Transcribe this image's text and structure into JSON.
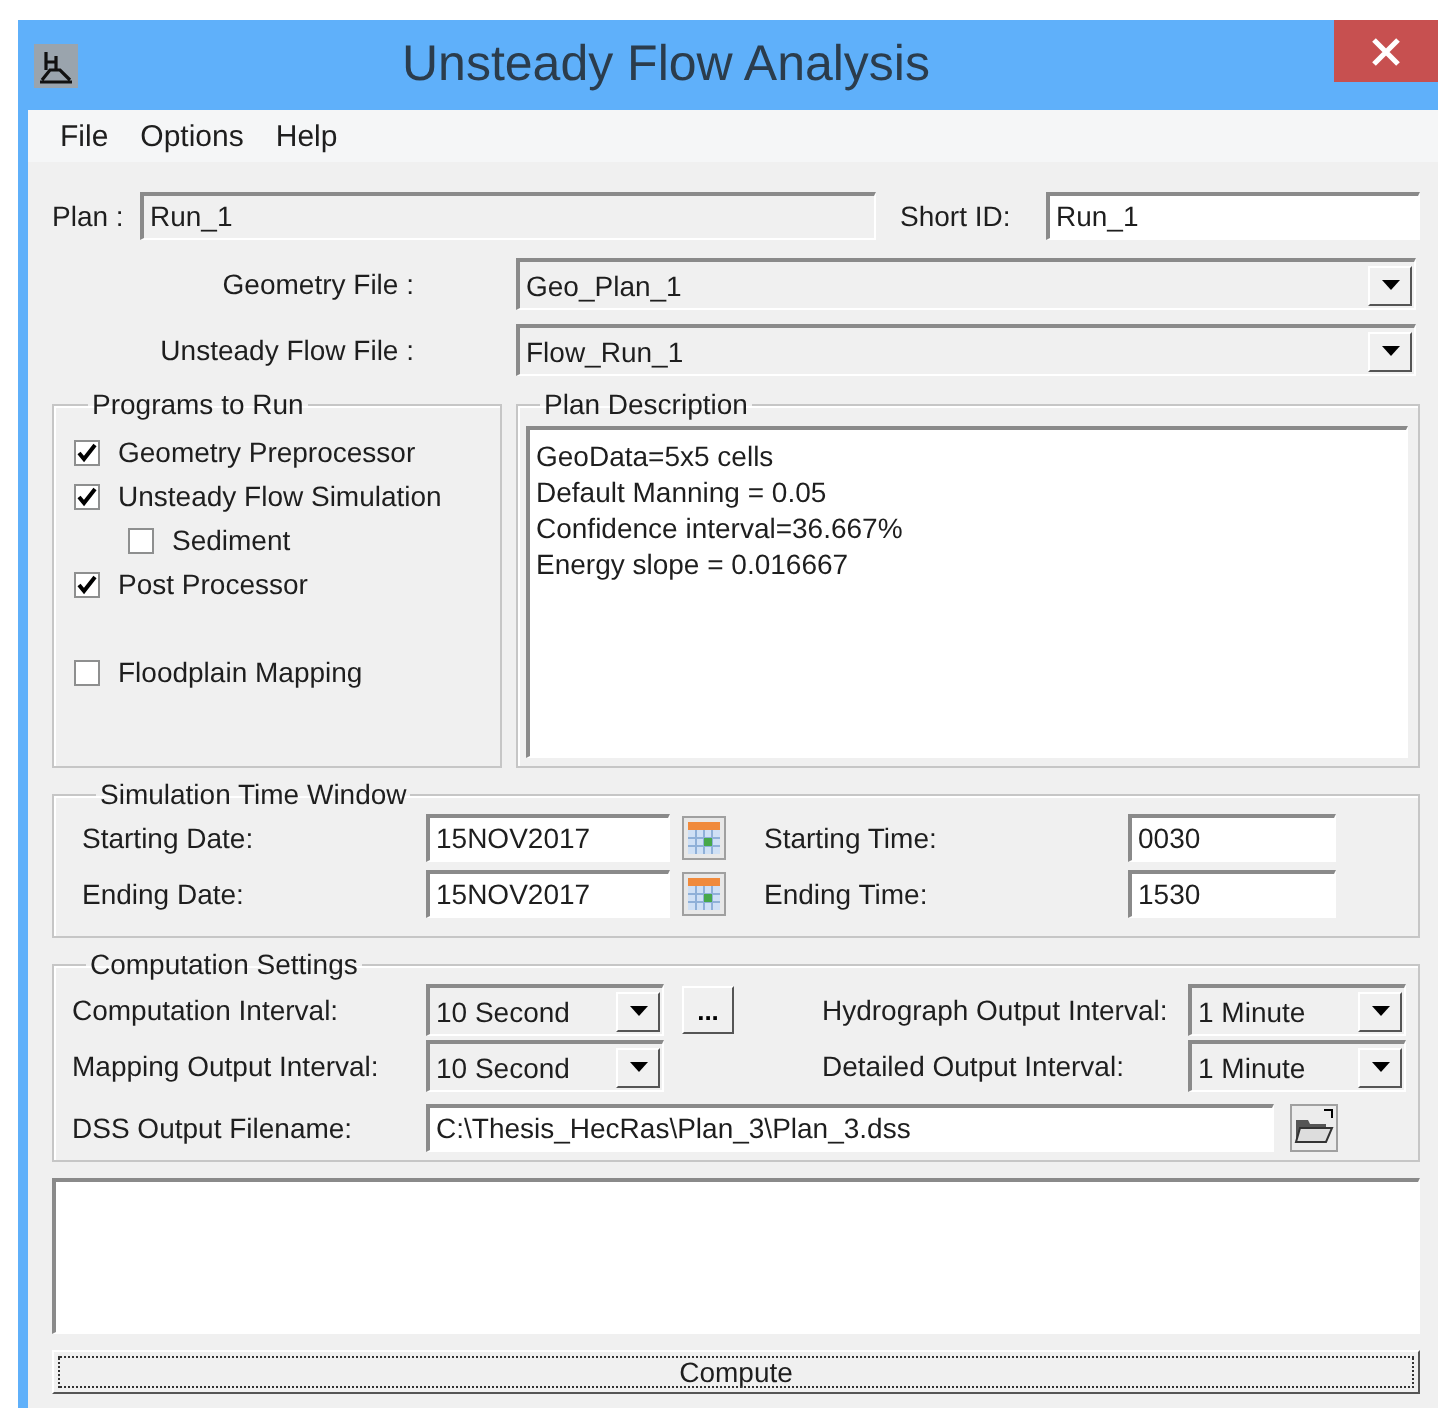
{
  "window": {
    "title": "Unsteady Flow Analysis"
  },
  "menu": [
    {
      "label": "File"
    },
    {
      "label": "Options"
    },
    {
      "label": "Help"
    }
  ],
  "plan": {
    "label": "Plan :",
    "value": "Run_1",
    "disabled": true
  },
  "short_id": {
    "label": "Short ID:",
    "value": "Run_1",
    "disabled": false
  },
  "geometry_file": {
    "label": "Geometry File :",
    "value": "Geo_Plan_1"
  },
  "unsteady_flow_file": {
    "label": "Unsteady Flow File :",
    "value": "Flow_Run_1"
  },
  "programs": {
    "title": "Programs to Run",
    "items": [
      {
        "label": "Geometry Preprocessor",
        "checked": true
      },
      {
        "label": "Unsteady Flow Simulation",
        "checked": true,
        "children": [
          {
            "label": "Sediment",
            "checked": false
          }
        ]
      },
      {
        "label": "Post Processor",
        "checked": true
      },
      {
        "label": "Floodplain Mapping",
        "checked": false
      }
    ]
  },
  "plan_description": {
    "title": "Plan Description",
    "lines": [
      "GeoData=5x5 cells",
      "Default Manning = 0.05",
      "Confidence interval=36.667%",
      "Energy slope = 0.016667"
    ]
  },
  "simulation_time_window": {
    "title": "Simulation Time Window",
    "rows": [
      {
        "date_label": "Starting Date:",
        "date_value": "15NOV2017",
        "time_label": "Starting Time:",
        "time_value": "0030"
      },
      {
        "date_label": "Ending Date:",
        "date_value": "15NOV2017",
        "time_label": "Ending Time:",
        "time_value": "1530"
      }
    ]
  },
  "computation_settings": {
    "title": "Computation Settings",
    "rows": [
      {
        "left_label": "Computation Interval:",
        "left_value": "10 Second",
        "more_button": "...",
        "right_label": "Hydrograph Output Interval:",
        "right_value": "1 Minute"
      },
      {
        "left_label": "Mapping Output Interval:",
        "left_value": "10 Second",
        "right_label": "Detailed Output Interval:",
        "right_value": "1 Minute"
      }
    ],
    "dss": {
      "label": "DSS Output Filename:",
      "value": "C:\\Thesis_HecRas\\Plan_3\\Plan_3.dss"
    }
  },
  "compute_button": {
    "label": "Compute"
  }
}
